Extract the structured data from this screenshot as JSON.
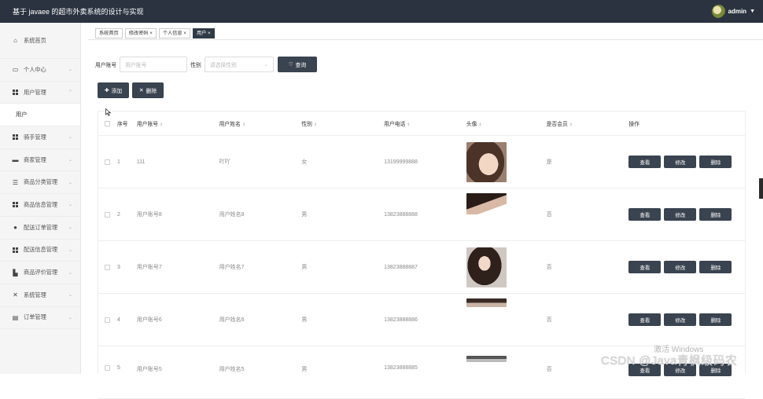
{
  "header": {
    "title": "基于 javaee 的超市外卖系统的设计与实现",
    "username": "admin"
  },
  "sidebar": {
    "items": [
      {
        "label": "系统首页",
        "icon": "home-icon"
      },
      {
        "label": "个人中心",
        "icon": "window-icon"
      },
      {
        "label": "用户管理",
        "icon": "grid-icon"
      },
      {
        "label": "用户",
        "icon": ""
      },
      {
        "label": "骑手管理",
        "icon": "grid-icon"
      },
      {
        "label": "商家管理",
        "icon": "briefcase-icon"
      },
      {
        "label": "商品分类管理",
        "icon": "list-icon"
      },
      {
        "label": "商品信息管理",
        "icon": "grid-icon"
      },
      {
        "label": "配送订单管理",
        "icon": "location-icon"
      },
      {
        "label": "配送信息管理",
        "icon": "grid-icon"
      },
      {
        "label": "商品评价管理",
        "icon": "chart-icon"
      },
      {
        "label": "系统管理",
        "icon": "layers-icon"
      },
      {
        "label": "订单管理",
        "icon": "clipboard-icon"
      }
    ]
  },
  "tabs": [
    {
      "label": "系统首页"
    },
    {
      "label": "修改密码 ×"
    },
    {
      "label": "个人信息 ×"
    },
    {
      "label": "用户 ×"
    }
  ],
  "search": {
    "account_label": "用户账号",
    "account_placeholder": "用户账号",
    "gender_label": "性别",
    "gender_placeholder": "请选择性别",
    "query_button": "查询"
  },
  "toolbar": {
    "add_label": "添加",
    "delete_label": "删除"
  },
  "table": {
    "columns": [
      "序号",
      "用户账号",
      "用户姓名",
      "性别",
      "用户电话",
      "头像",
      "是否会员",
      "操作"
    ],
    "rows": [
      {
        "index": "1",
        "account": "111",
        "name": "吖吖",
        "gender": "女",
        "phone": "13199999888",
        "vip": "是"
      },
      {
        "index": "2",
        "account": "用户账号8",
        "name": "用户姓名8",
        "gender": "男",
        "phone": "13823888888",
        "vip": "否"
      },
      {
        "index": "3",
        "account": "用户账号7",
        "name": "用户姓名7",
        "gender": "男",
        "phone": "13823888887",
        "vip": "否"
      },
      {
        "index": "4",
        "account": "用户账号6",
        "name": "用户姓名6",
        "gender": "男",
        "phone": "13823888886",
        "vip": "否"
      },
      {
        "index": "5",
        "account": "用户账号5",
        "name": "用户姓名5",
        "gender": "男",
        "phone": "13823888885",
        "vip": "否"
      }
    ],
    "ops": {
      "view": "查看",
      "edit": "修改",
      "delete": "删除"
    }
  },
  "watermarks": {
    "activate": "激活 Windows",
    "csdn": "CSDN @Java青枫级码农"
  },
  "colors": {
    "topbar": "#2b3340",
    "button": "#3a4350",
    "active_tab": "#303a47"
  }
}
